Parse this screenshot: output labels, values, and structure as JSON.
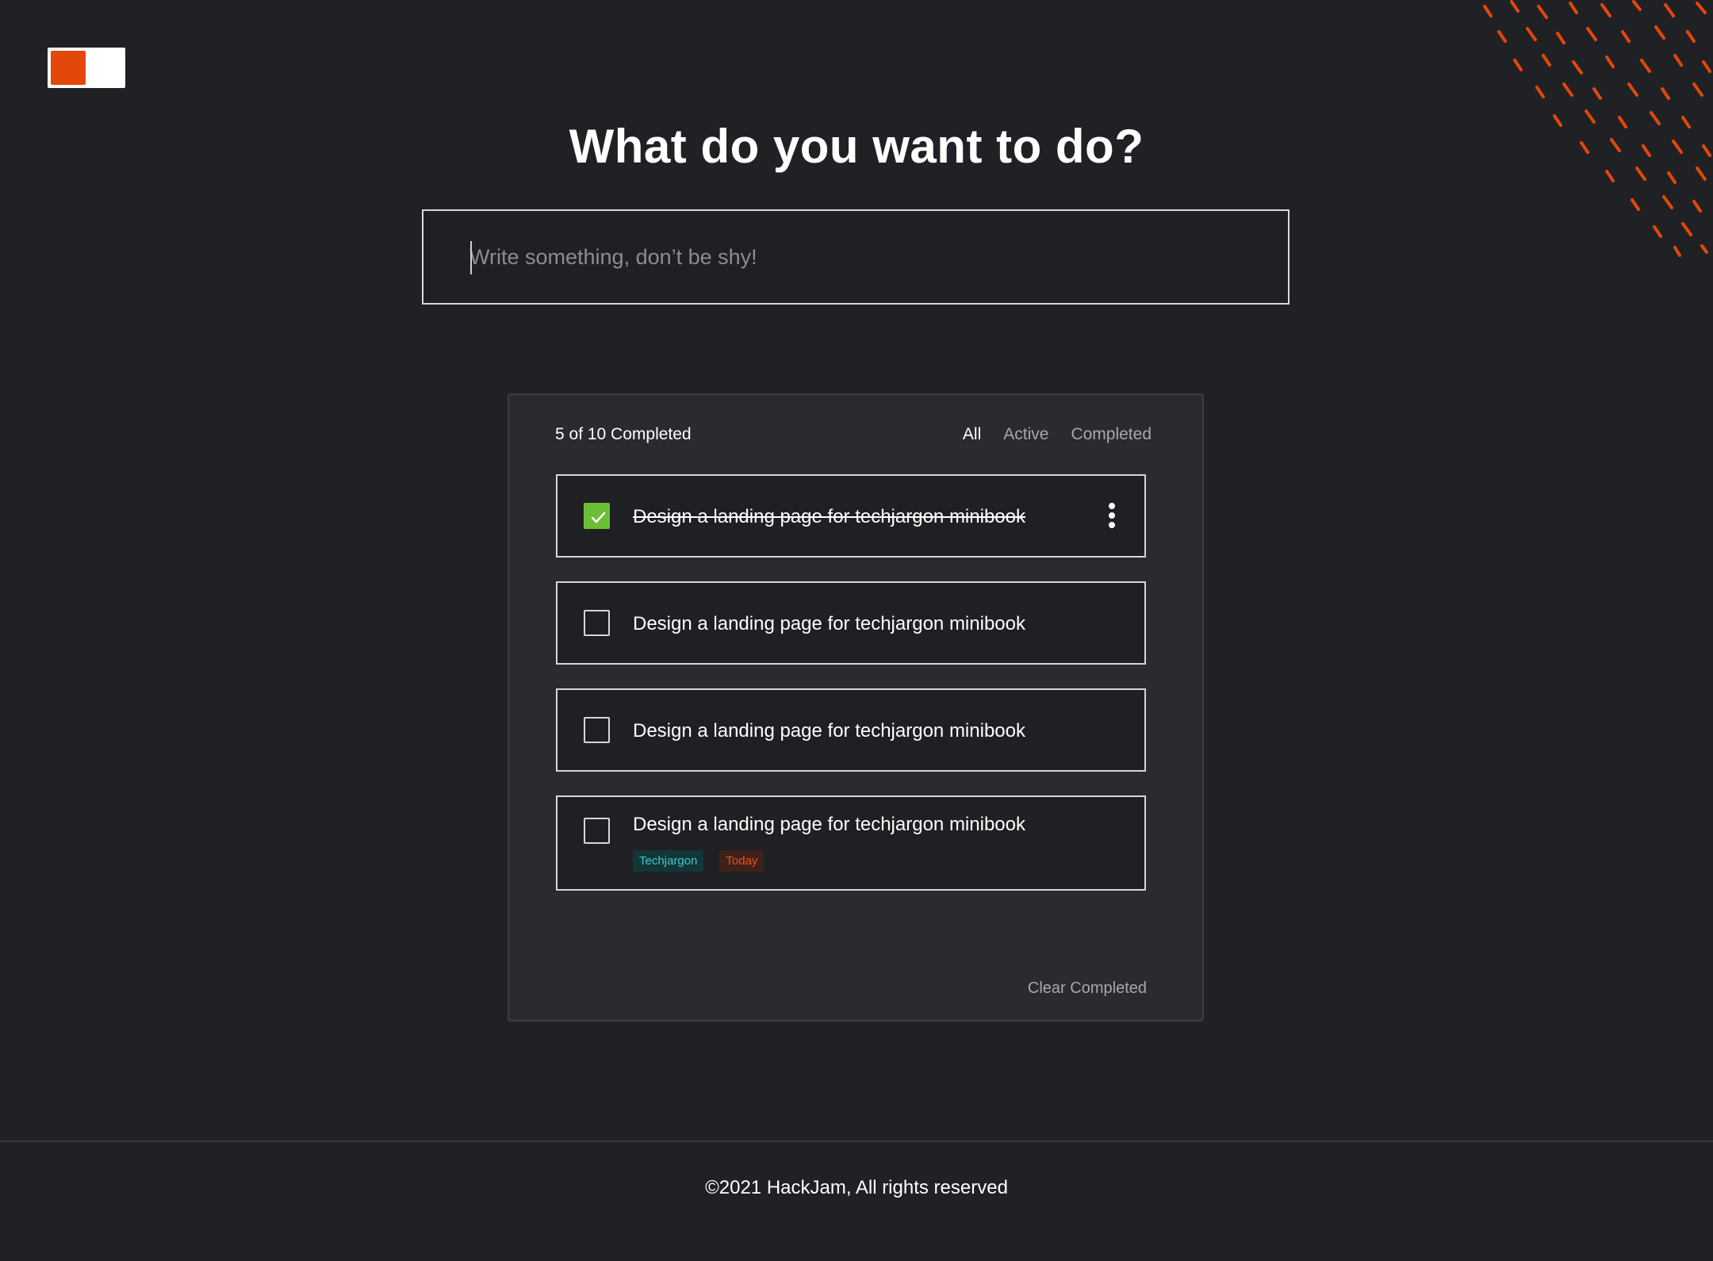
{
  "heading": "What do you want to do?",
  "new_task": {
    "placeholder": "Write something, don’t be shy!",
    "value": ""
  },
  "panel": {
    "count_text": "5 of 10 Completed",
    "filters": [
      "All",
      "Active",
      "Completed"
    ],
    "active_filter": "All",
    "clear_label": "Clear Completed"
  },
  "tasks": [
    {
      "title": "Design a landing page for techjargon minibook",
      "completed": true,
      "tags": []
    },
    {
      "title": "Design a landing page for techjargon minibook",
      "completed": false,
      "tags": []
    },
    {
      "title": "Design a landing page for techjargon minibook",
      "completed": false,
      "tags": []
    },
    {
      "title": "Design a landing page for techjargon minibook",
      "completed": false,
      "tags": [
        "Techjargon",
        "Today"
      ]
    }
  ],
  "colors": {
    "background": "#202125",
    "accent": "#e3470a",
    "check_done": "#6bbf37",
    "tag_teal": "#42c6c8",
    "tag_orange": "#e4531d"
  },
  "footer": "©2021 HackJam, All rights reserved"
}
